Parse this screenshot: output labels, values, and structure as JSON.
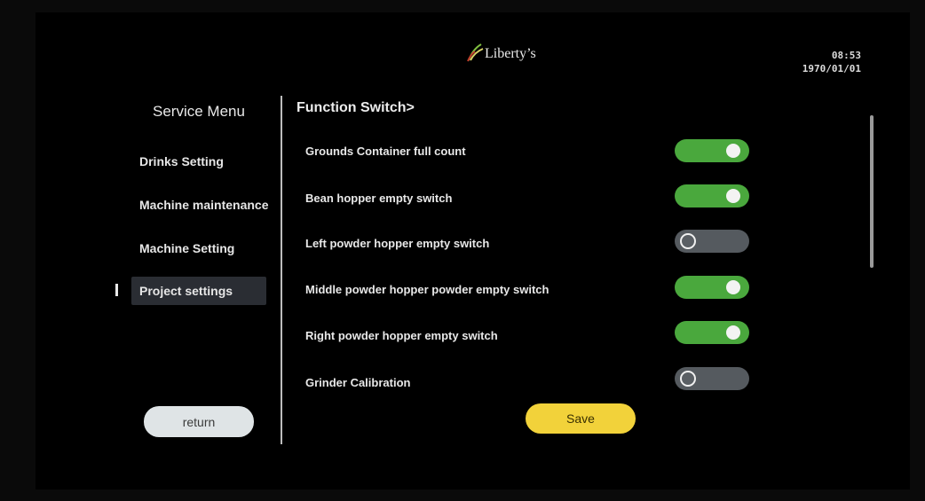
{
  "header": {
    "logo_text": "Liberty’s",
    "time": "08:53",
    "date": "1970/01/01"
  },
  "sidebar": {
    "title": "Service Menu",
    "items": [
      {
        "label": "Drinks Setting",
        "active": false
      },
      {
        "label": "Machine maintenance",
        "active": false
      },
      {
        "label": "Machine Setting",
        "active": false
      },
      {
        "label": "Project settings",
        "active": true
      }
    ],
    "return_label": "return"
  },
  "main": {
    "section_title": "Function Switch>",
    "switches": [
      {
        "label": "Grounds Container full count",
        "state": "on"
      },
      {
        "label": "Bean hopper empty switch",
        "state": "on"
      },
      {
        "label": "Left powder hopper empty switch",
        "state": "off"
      },
      {
        "label": "Middle powder hopper powder empty switch",
        "state": "on"
      },
      {
        "label": "Right powder hopper empty switch",
        "state": "on"
      },
      {
        "label": "Grinder Calibration",
        "state": "off"
      }
    ],
    "save_label": "Save"
  },
  "colors": {
    "toggle_on": "#4aa83d",
    "toggle_off": "#555a5f",
    "save_button": "#f2d23a",
    "return_button": "#dfe4e6"
  }
}
